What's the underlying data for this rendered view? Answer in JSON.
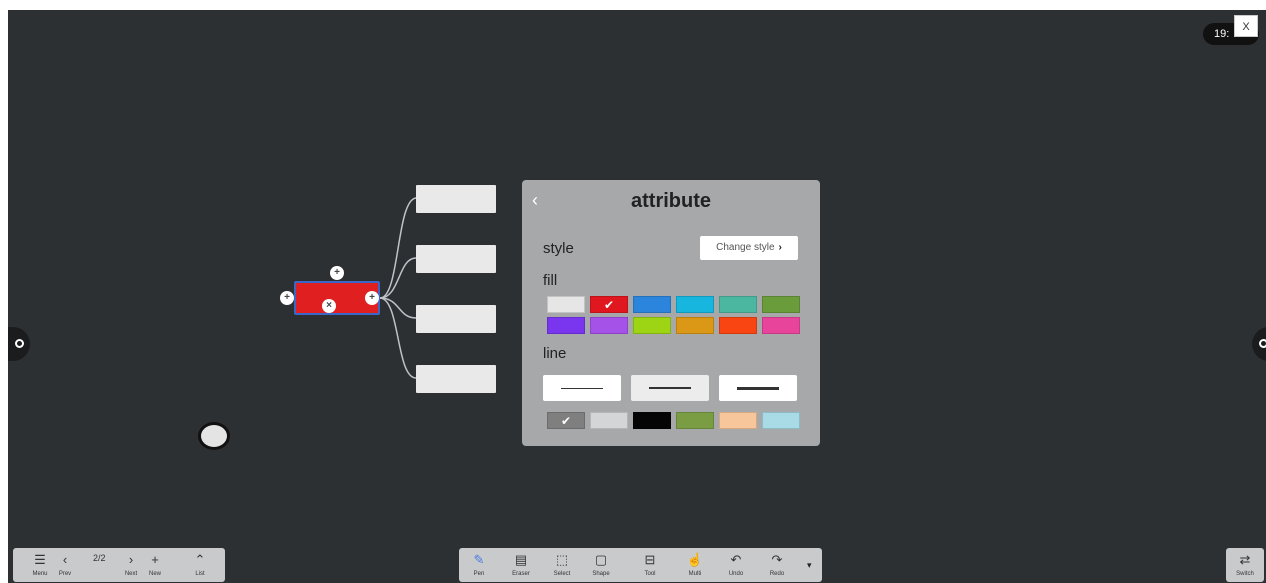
{
  "window": {
    "close_label": "X",
    "clock_partial": "19:"
  },
  "panel": {
    "title": "attribute",
    "back_icon": "‹",
    "style_label": "style",
    "change_style_label": "Change style",
    "change_style_arrow": "›",
    "fill_label": "fill",
    "line_label": "line",
    "fill_colors": [
      "#e6e6e6",
      "#e0171f",
      "#2b85dd",
      "#16b6de",
      "#4cb7a0",
      "#6a9c3c",
      "#7a35ef",
      "#a552e8",
      "#9dd414",
      "#db9716",
      "#f84511",
      "#e9449c"
    ],
    "fill_selected_index": 1,
    "line_styles": [
      "thin",
      "medium",
      "thick"
    ],
    "line_style_selected_index": 1,
    "line_colors": [
      "#7f7f7f",
      "#d4d5d6",
      "#050505",
      "#7a9d44",
      "#f8c69b",
      "#a9dbe7"
    ],
    "line_color_selected_index": 0,
    "check_mark": "✔"
  },
  "mindmap": {
    "root_fill": "#e02020",
    "root_border": "#3b67c8",
    "children_count": 4,
    "handle_top_symbol": "+",
    "handle_left_symbol": "+",
    "handle_right_symbol": "+",
    "handle_bottom_symbol": "×"
  },
  "toolbar_left": {
    "menu_label": "Menu",
    "menu_icon": "☰",
    "prev_label": "Prev",
    "prev_icon": "‹",
    "page_indicator": "2/2",
    "next_label": "Next",
    "next_icon": "›",
    "new_label": "New",
    "new_icon": "+",
    "list_label": "List",
    "list_icon": "⌃"
  },
  "toolbar_main": {
    "pen_label": "Pen",
    "pen_icon": "✎",
    "eraser_label": "Eraser",
    "eraser_icon": "▤",
    "select_label": "Select",
    "select_icon": "⬚",
    "shape_label": "Shape",
    "shape_icon": "▢",
    "tool_label": "Tool",
    "tool_icon": "⊟",
    "multi_label": "Multi",
    "multi_icon": "☝",
    "undo_label": "Undo",
    "undo_icon": "↶",
    "redo_label": "Redo",
    "redo_icon": "↷",
    "more_icon": "▾",
    "active_color": "#4a7de0"
  },
  "toolbar_right": {
    "switch_label": "Switch",
    "switch_icon": "⇄"
  }
}
